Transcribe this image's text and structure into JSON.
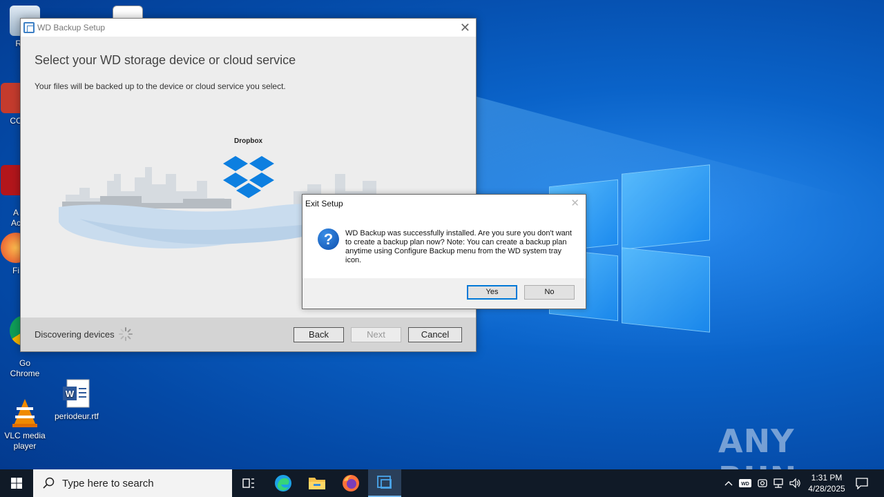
{
  "desktop": {
    "icons": [
      {
        "label": "Recy",
        "name": "recycle-bin"
      },
      {
        "label": "CC",
        "name": "ccleaner"
      },
      {
        "label": "A\nAc",
        "name": "acrobat"
      },
      {
        "label": "Fi",
        "name": "firefox"
      },
      {
        "label": "Go\nChrome",
        "name": "chrome"
      },
      {
        "label": "VLC media\nplayer",
        "name": "vlc"
      },
      {
        "label": "periodeur.rtf",
        "name": "word-doc"
      }
    ],
    "watermark": "ANY RUN"
  },
  "wd_window": {
    "title": "WD Backup Setup",
    "heading": "Select your WD storage device or cloud service",
    "subtitle": "Your files will be backed up to the device or cloud service you select.",
    "service_label": "Dropbox",
    "status": "Discovering devices",
    "buttons": {
      "back": "Back",
      "next": "Next",
      "cancel": "Cancel"
    }
  },
  "dialog": {
    "title": "Exit Setup",
    "message": "WD Backup was successfully installed. Are you sure you don't want to create a backup plan now? Note: You can create a backup plan anytime using Configure Backup menu from the WD system tray icon.",
    "buttons": {
      "yes": "Yes",
      "no": "No"
    }
  },
  "taskbar": {
    "search_placeholder": "Type here to search",
    "time": "1:31 PM",
    "date": "4/28/2025",
    "apps": [
      "task-view",
      "edge",
      "file-explorer",
      "firefox",
      "wd-backup"
    ]
  },
  "colors": {
    "accent": "#0078d7",
    "dropbox_blue": "#0d7fe0",
    "taskbar": "#101a27"
  }
}
